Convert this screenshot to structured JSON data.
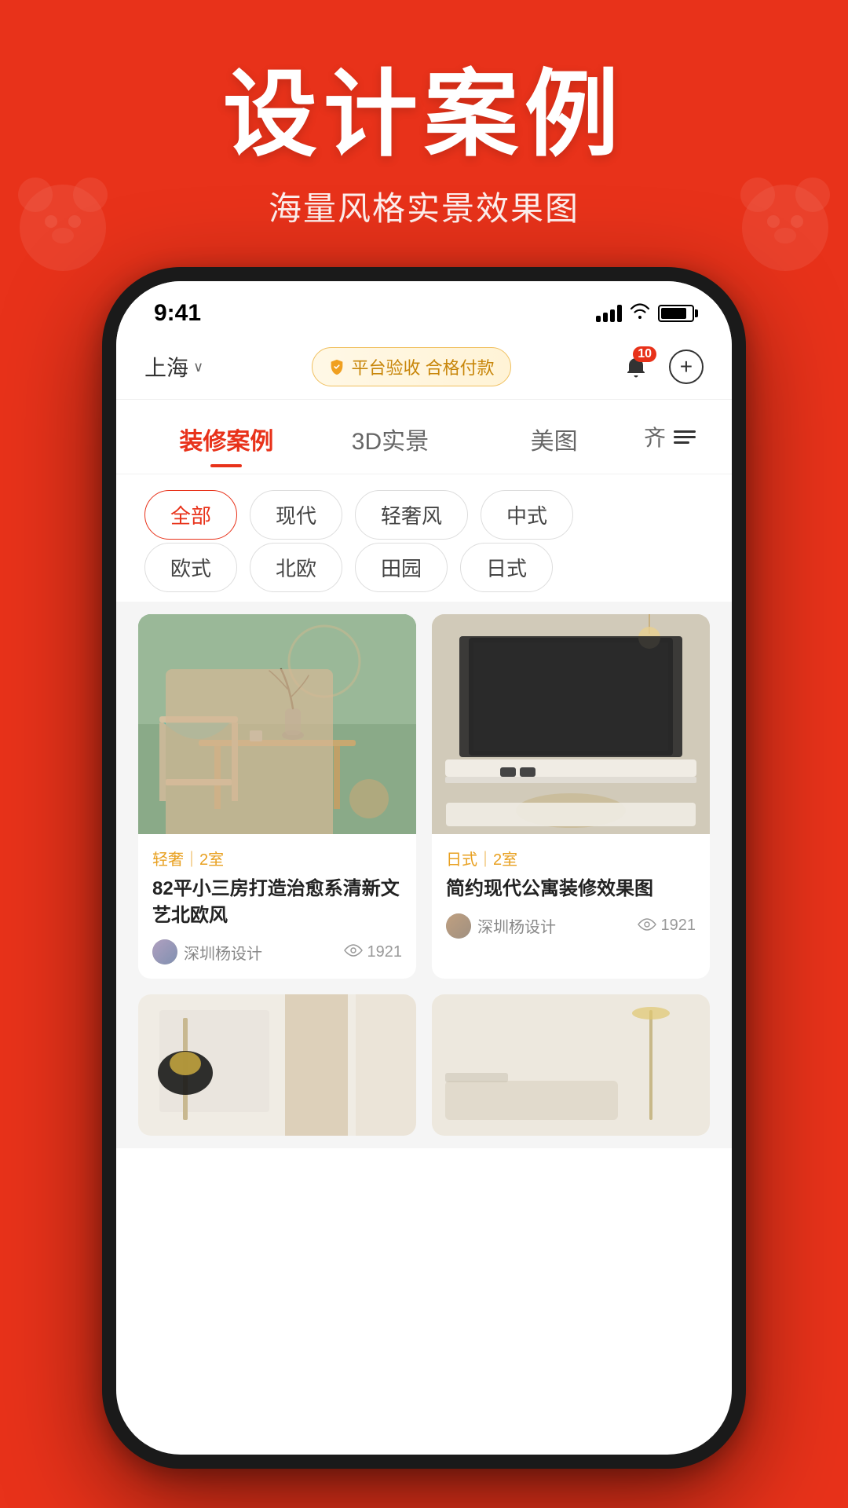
{
  "background": {
    "color": "#e8321a"
  },
  "header": {
    "main_title": "设计案例",
    "sub_title": "海量风格实景效果图"
  },
  "phone": {
    "status_bar": {
      "time": "9:41",
      "notification_count": "10"
    },
    "app_header": {
      "location": "上海",
      "location_dropdown": "›",
      "verify_text": "平台验收 合格付款",
      "add_label": "+"
    },
    "nav_tabs": [
      {
        "label": "装修案例",
        "active": true
      },
      {
        "label": "3D实景",
        "active": false
      },
      {
        "label": "美图",
        "active": false
      }
    ],
    "more_icon": "≡",
    "filter_chips": [
      {
        "label": "全部",
        "active": true
      },
      {
        "label": "现代",
        "active": false
      },
      {
        "label": "轻奢风",
        "active": false
      },
      {
        "label": "中式",
        "active": false
      },
      {
        "label": "欧式",
        "active": false
      },
      {
        "label": "北欧",
        "active": false
      },
      {
        "label": "田园",
        "active": false
      },
      {
        "label": "日式",
        "active": false
      }
    ],
    "cards": [
      {
        "tag": "轻奢｜2室",
        "title": "82平小三房打造治愈系清新文艺北欧风",
        "author": "深圳杨设计",
        "views": "1921",
        "image_type": "room1"
      },
      {
        "tag": "日式｜2室",
        "title": "简约现代公寓装修效果图",
        "author": "深圳杨设计",
        "views": "1921",
        "image_type": "room2"
      },
      {
        "tag": "",
        "title": "",
        "author": "",
        "views": "",
        "image_type": "room3"
      },
      {
        "tag": "",
        "title": "",
        "author": "",
        "views": "",
        "image_type": "room4"
      }
    ]
  }
}
